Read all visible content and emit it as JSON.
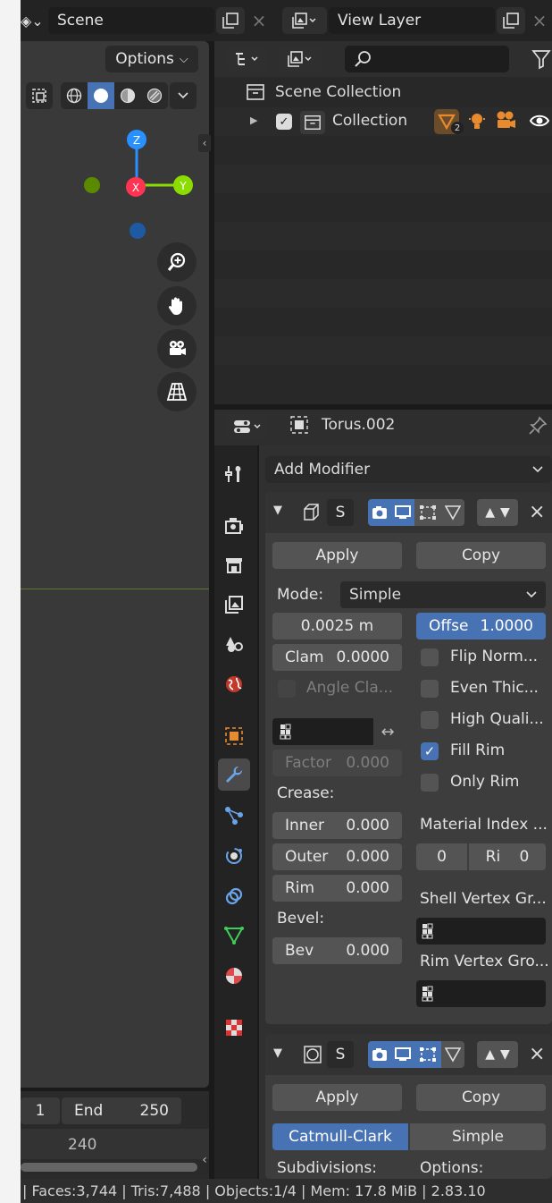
{
  "topbar": {
    "scene_label": "Scene",
    "view_layer_label": "View Layer"
  },
  "viewport": {
    "options_label": "Options",
    "gizmo": {
      "z": "Z",
      "x": "X",
      "y": "Y"
    }
  },
  "outliner": {
    "search_placeholder": "",
    "scene_collection": "Scene Collection",
    "collection": "Collection",
    "badge_count": "2"
  },
  "timeline": {
    "start_value": "1",
    "end_label": "End",
    "end_value": "250",
    "ruler_value": "240"
  },
  "properties": {
    "object_name": "Torus.002",
    "add_modifier": "Add Modifier",
    "mod1": {
      "realtime_toggle": "S",
      "apply": "Apply",
      "copy": "Copy",
      "mode_label": "Mode:",
      "mode_value": "Simple",
      "thickness": "0.0025 m",
      "offset_label": "Offse",
      "offset_value": "1.0000",
      "clamp_label": "Clam",
      "clamp_value": "0.0000",
      "angle_clamp": "Angle Cla...",
      "factor_label": "Factor",
      "factor_value": "0.000",
      "crease_label": "Crease:",
      "inner_label": "Inner",
      "inner_value": "0.000",
      "outer_label": "Outer",
      "outer_value": "0.000",
      "rim_label": "Rim",
      "rim_value": "0.000",
      "bevel_label": "Bevel:",
      "bev_label": "Bev",
      "bev_value": "0.000",
      "flip_normals": "Flip Norm...",
      "even_thickness": "Even Thic...",
      "high_quality": "High Quali...",
      "fill_rim": "Fill Rim",
      "only_rim": "Only Rim",
      "material_index": "Material Index ...",
      "mat_value": "0",
      "ri_label": "Ri",
      "ri_value": "0",
      "shell_vg": "Shell Vertex Gr...",
      "rim_vg": "Rim Vertex Gro..."
    },
    "mod2": {
      "realtime_toggle": "S",
      "apply": "Apply",
      "copy": "Copy",
      "catmull": "Catmull-Clark",
      "simple": "Simple",
      "subdivisions": "Subdivisions:",
      "options": "Options:"
    }
  },
  "statusbar": {
    "text": "| Faces:3,744 | Tris:7,488 | Objects:1/4 | Mem: 17.8 MiB | 2.83.10"
  },
  "colors": {
    "accent_blue": "#4772b3",
    "axis_x": "#ff3352",
    "axis_y": "#8bdc00",
    "axis_z": "#2890ff",
    "orange": "#e88a2e"
  }
}
